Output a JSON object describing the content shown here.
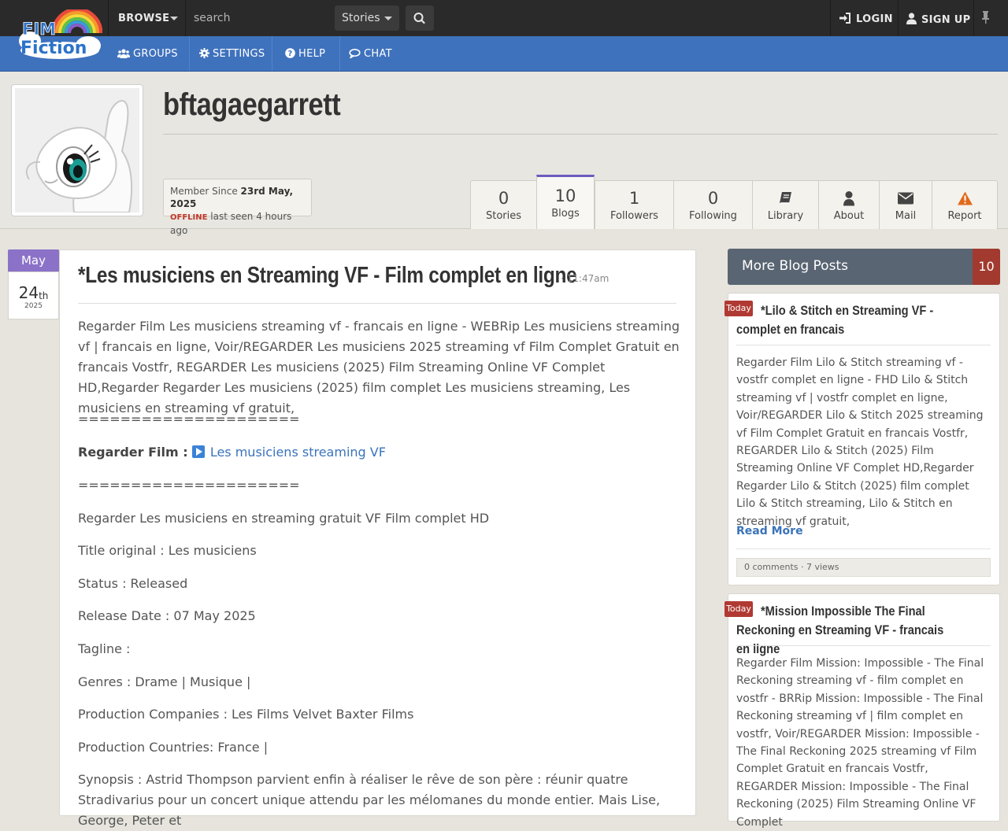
{
  "topbar": {
    "logo_text_1": "FIM",
    "logo_text_2": "Fiction",
    "browse_label": "BROWSE",
    "search_placeholder": "search",
    "search_scope": "Stories",
    "login_label": "LOGIN",
    "signup_label": "SIGN UP"
  },
  "nav": {
    "items": [
      {
        "label": "GROUPS",
        "icon": "users-icon"
      },
      {
        "label": "SETTINGS",
        "icon": "gear-icon"
      },
      {
        "label": "HELP",
        "icon": "question-circle-icon"
      },
      {
        "label": "CHAT",
        "icon": "chat-icon"
      }
    ]
  },
  "profile": {
    "username": "bftagaegarrett",
    "member_since_label": "Member Since",
    "member_since_date": "23rd May, 2025",
    "status": "OFFLINE",
    "last_seen": "last seen 4 hours ago",
    "tabs": [
      {
        "num": "0",
        "label": "Stories"
      },
      {
        "num": "10",
        "label": "Blogs"
      },
      {
        "num": "1",
        "label": "Followers"
      },
      {
        "num": "0",
        "label": "Following"
      },
      {
        "label": "Library",
        "icon": "book-icon"
      },
      {
        "label": "About",
        "icon": "user-icon"
      },
      {
        "label": "Mail",
        "icon": "envelope-icon"
      },
      {
        "label": "Report",
        "icon": "warning-icon"
      }
    ]
  },
  "post": {
    "month": "May",
    "day": "24",
    "day_suffix": "th",
    "year": "2025",
    "title": "*Les musiciens en Streaming VF - Film complet en ligne",
    "time": "· 11:47am",
    "intro": "Regarder Film Les musiciens streaming vf - francais en ligne - WEBRip Les musiciens streaming vf | francais en ligne, Voir/REGARDER Les musiciens 2025 streaming vf Film Complet Gratuit en francais Vostfr, REGARDER Les musiciens (2025) Film Streaming Online VF Complet HD,Regarder Regarder Les musiciens (2025) film complet Les musiciens streaming, Les musiciens en streaming vf gratuit,",
    "separator": "=====================",
    "watch_label": "Regarder Film :",
    "watch_link": "Les musiciens streaming VF",
    "lines": [
      "Regarder Les musiciens en streaming gratuit VF Film complet HD",
      "Title original : Les musiciens",
      "Status : Released",
      "Release Date : 07 May 2025",
      "Tagline :",
      "Genres : Drame | Musique |",
      "Production Companies : Les Films Velvet Baxter Films",
      "Production Countries: France |"
    ],
    "synopsis": "Synopsis : Astrid Thompson parvient enfin à réaliser le rêve de son père : réunir quatre Stradivarius pour un concert unique attendu par les mélomanes du monde entier. Mais Lise, George, Peter et"
  },
  "sidebar": {
    "header": "More Blog Posts",
    "count": "10",
    "cards": [
      {
        "badge": "Today",
        "title": "*Lilo & Stitch en Streaming VF - complet en francais",
        "text": "Regarder Film Lilo & Stitch streaming vf - vostfr complet en ligne - FHD Lilo & Stitch streaming vf | vostfr complet en ligne, Voir/REGARDER Lilo & Stitch 2025 streaming vf Film Complet Gratuit en francais Vostfr, REGARDER Lilo & Stitch (2025) Film Streaming Online VF Complet HD,Regarder Regarder Lilo & Stitch (2025) film complet Lilo & Stitch streaming, Lilo & Stitch en streaming vf gratuit,",
        "read_more": "Read More",
        "stats": "0 comments · 7 views"
      },
      {
        "badge": "Today",
        "title": "*Mission Impossible The Final Reckoning en Streaming VF - francais en ligne",
        "text": "Regarder Film Mission: Impossible - The Final Reckoning streaming vf - film complet en vostfr - BRRip Mission: Impossible - The Final Reckoning streaming vf | film complet en vostfr, Voir/REGARDER Mission: Impossible - The Final Reckoning 2025 streaming vf Film Complet Gratuit en francais Vostfr, REGARDER Mission: Impossible - The Final Reckoning (2025) Film Streaming Online VF Complet"
      }
    ]
  },
  "colors": {
    "topbar": "#2a2a2a",
    "navbar": "#3f72bd",
    "month_badge": "#8b72c8",
    "today_badge": "#b03a33",
    "link": "#3a73ba",
    "sidebar_header": "#5a6573",
    "count_badge": "#a23a2f"
  }
}
